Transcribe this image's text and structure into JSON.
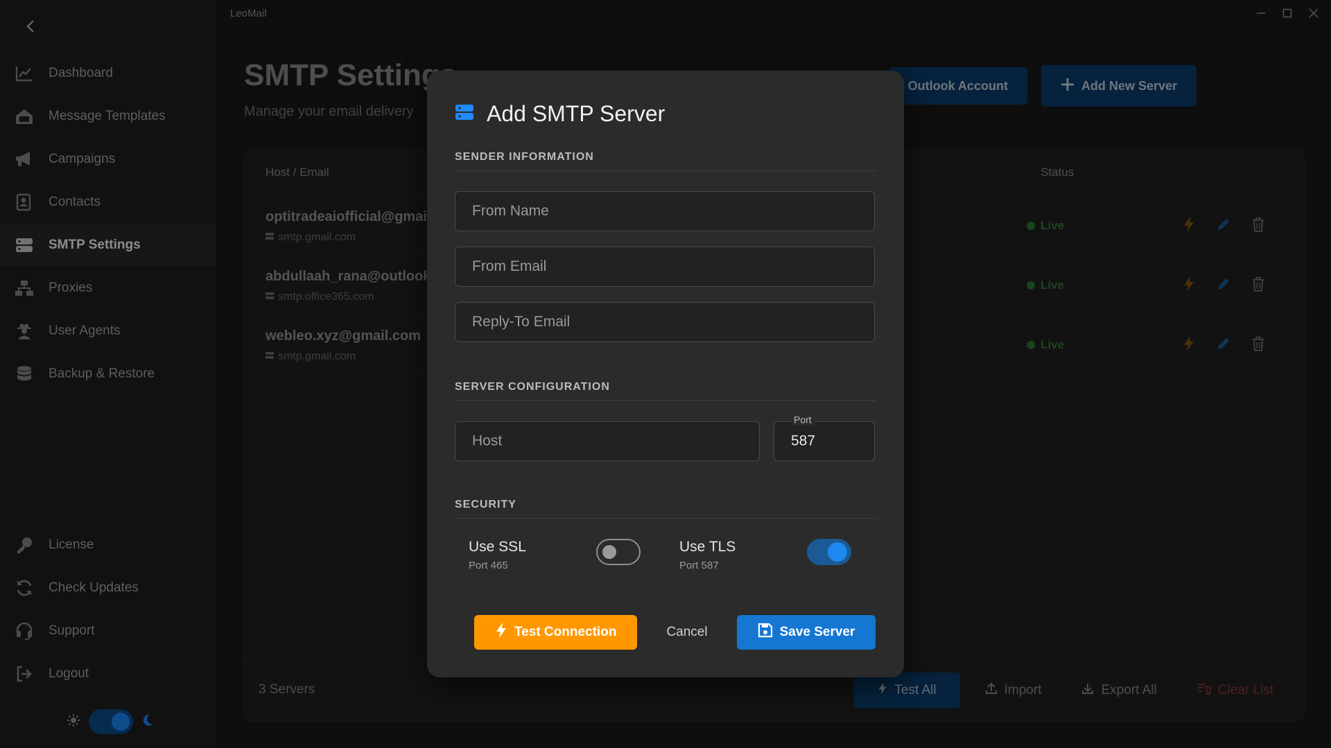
{
  "app": {
    "title": "LeoMail"
  },
  "sidebar": {
    "items": [
      {
        "label": "Dashboard",
        "icon": "chart-line-icon"
      },
      {
        "label": "Message Templates",
        "icon": "templates-icon"
      },
      {
        "label": "Campaigns",
        "icon": "megaphone-icon"
      },
      {
        "label": "Contacts",
        "icon": "contacts-icon"
      },
      {
        "label": "SMTP Settings",
        "icon": "server-icon",
        "active": true
      },
      {
        "label": "Proxies",
        "icon": "network-icon"
      },
      {
        "label": "User Agents",
        "icon": "user-secret-icon"
      },
      {
        "label": "Backup & Restore",
        "icon": "database-icon"
      }
    ],
    "bottom_items": [
      {
        "label": "License",
        "icon": "key-icon"
      },
      {
        "label": "Check Updates",
        "icon": "sync-icon"
      },
      {
        "label": "Support",
        "icon": "headset-icon"
      },
      {
        "label": "Logout",
        "icon": "logout-icon"
      }
    ]
  },
  "page": {
    "title": "SMTP Settings",
    "subtitle": "Manage your email delivery",
    "outlook_button": "Outlook Account",
    "add_button": "Add New Server"
  },
  "table": {
    "headers": {
      "host": "Host / Email",
      "status": "Status"
    },
    "rows": [
      {
        "email": "optitradeaiofficial@gmail.",
        "host": "smtp.gmail.com",
        "status": "Live"
      },
      {
        "email": "abdullaah_rana@outlook.c",
        "host": "smtp.office365.com",
        "status": "Live"
      },
      {
        "email": "webleo.xyz@gmail.com",
        "host": "smtp.gmail.com",
        "status": "Live"
      }
    ],
    "footer": {
      "count": "3 Servers",
      "test_all": "Test All",
      "import": "Import",
      "export_all": "Export All",
      "clear_list": "Clear List"
    }
  },
  "modal": {
    "title": "Add SMTP Server",
    "sender_section": "SENDER INFORMATION",
    "from_name_placeholder": "From Name",
    "from_email_placeholder": "From Email",
    "reply_to_placeholder": "Reply-To Email",
    "server_section": "SERVER CONFIGURATION",
    "host_placeholder": "Host",
    "port_label": "Port",
    "port_value": "587",
    "security_section": "SECURITY",
    "ssl_label": "Use SSL",
    "ssl_sub": "Port 465",
    "ssl_enabled": false,
    "tls_label": "Use TLS",
    "tls_sub": "Port 587",
    "tls_enabled": true,
    "test_button": "Test Connection",
    "cancel_button": "Cancel",
    "save_button": "Save Server"
  },
  "colors": {
    "accent_blue": "#1677d2",
    "accent_orange": "#ff9800",
    "live_green": "#2f7d34",
    "danger_red": "#8c3a37"
  }
}
